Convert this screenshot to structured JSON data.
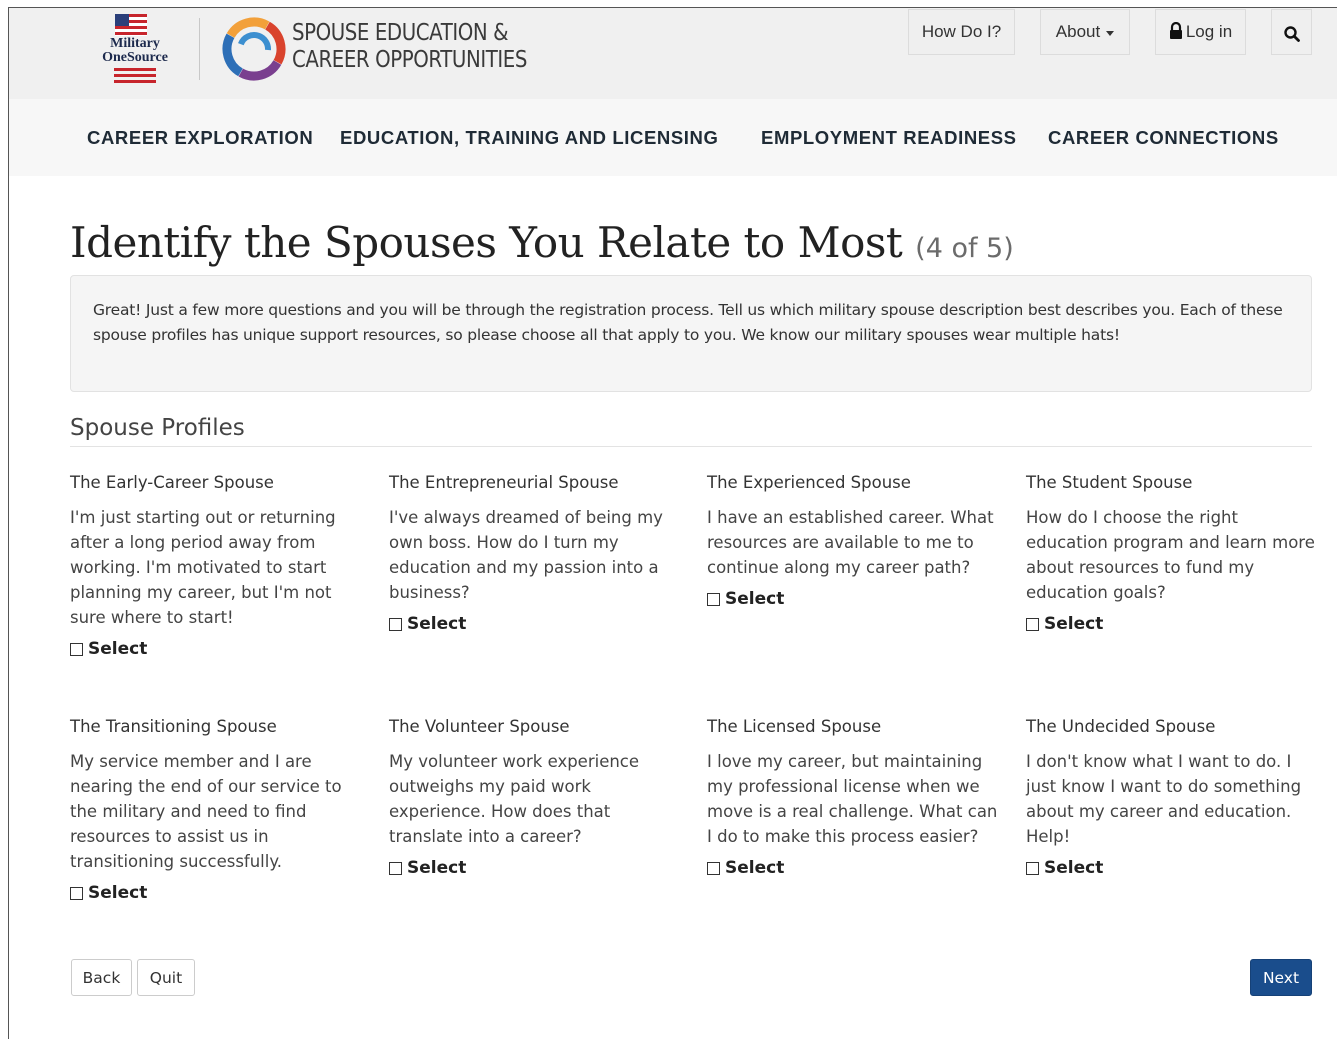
{
  "header": {
    "logo_military_line1": "Military",
    "logo_military_line2": "OneSource",
    "site_title_line1": "SPOUSE EDUCATION &",
    "site_title_line2": "CAREER OPPORTUNITIES",
    "utility": {
      "how_do_i": "How Do I?",
      "about": "About",
      "login": "Log in"
    }
  },
  "nav": {
    "items": [
      {
        "label": "CAREER EXPLORATION"
      },
      {
        "label": "EDUCATION, TRAINING AND LICENSING"
      },
      {
        "label": "EMPLOYMENT READINESS"
      },
      {
        "label": "CAREER CONNECTIONS"
      }
    ]
  },
  "page": {
    "title": "Identify the Spouses You Relate to Most",
    "step": "(4 of 5)",
    "intro": "Great! Just a few more questions and you will be through the registration process. Tell us which military spouse description best describes you. Each of these spouse profiles has unique support resources, so please choose all that apply to you. We know our military spouses wear multiple hats!",
    "section_heading": "Spouse Profiles"
  },
  "profiles": [
    {
      "title": "The Early-Career Spouse",
      "description": "I'm just starting out or returning after a long period away from working. I'm motivated to start planning my career, but I'm not sure where to start!",
      "select_label": "Select"
    },
    {
      "title": "The Entrepreneurial Spouse",
      "description": "I've always dreamed of being my own boss. How do I turn my education and my passion into a business?",
      "select_label": "Select"
    },
    {
      "title": "The Experienced Spouse",
      "description": "I have an established career. What resources are available to me to continue along my career path?",
      "select_label": "Select"
    },
    {
      "title": "The Student Spouse",
      "description": "How do I choose the right education program and learn more about resources to fund my education goals?",
      "select_label": "Select"
    },
    {
      "title": "The Transitioning Spouse",
      "description": "My service member and I are nearing the end of our service to the military and need to find resources to assist us in transitioning successfully.",
      "select_label": "Select"
    },
    {
      "title": "The Volunteer Spouse",
      "description": "My volunteer work experience outweighs my paid work experience. How does that translate into a career?",
      "select_label": "Select"
    },
    {
      "title": "The Licensed Spouse",
      "description": "I love my career, but maintaining my professional license when we move is a real challenge. What can I do to make this process easier?",
      "select_label": "Select"
    },
    {
      "title": "The Undecided Spouse",
      "description": "I don't know what I want to do. I just know I want to do something about my career and education. Help!",
      "select_label": "Select"
    }
  ],
  "actions": {
    "back": "Back",
    "quit": "Quit",
    "next": "Next"
  },
  "colors": {
    "primary_button": "#1a4d8c",
    "header_bg": "#f0f0f0",
    "nav_bg": "#f7f7f7"
  }
}
